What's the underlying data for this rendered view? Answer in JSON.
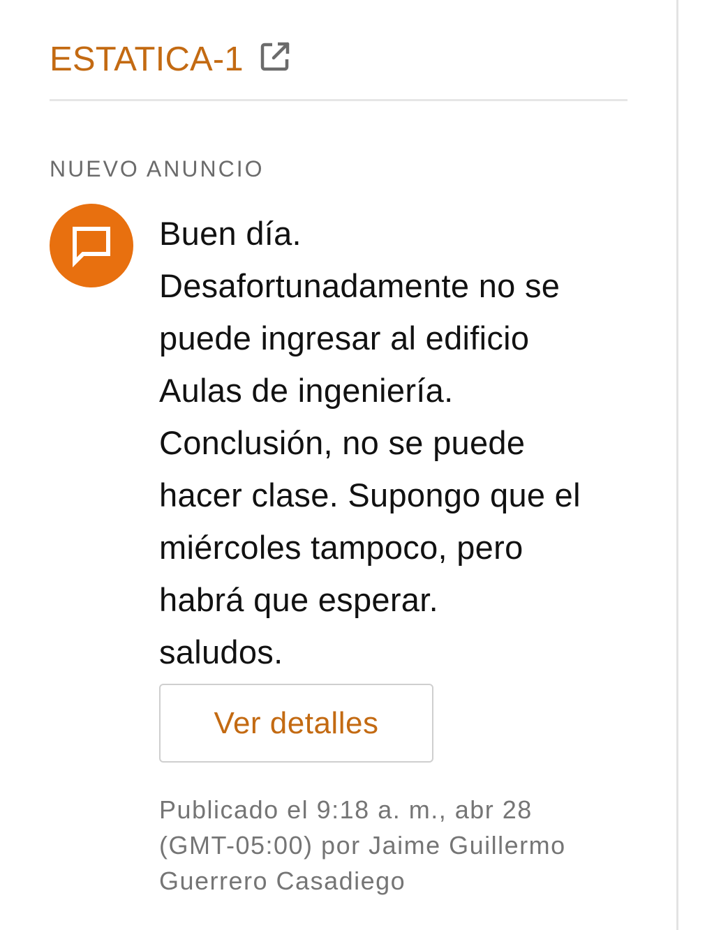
{
  "course": {
    "title": "ESTATICA-1",
    "link_icon": "external-link-icon"
  },
  "section": {
    "label": "NUEVO ANUNCIO"
  },
  "announcement": {
    "icon": "message-bubble-icon",
    "accent_color": "#e8700f",
    "body_lines": [
      "Buen día.",
      "Desafortunadamente no se",
      "puede ingresar al edificio",
      "Aulas de ingeniería.",
      "Conclusión, no se puede",
      "hacer clase. Supongo que el",
      "miércoles tampoco, pero",
      "habrá que esperar.",
      "saludos."
    ],
    "details_button": "Ver detalles",
    "meta_lines": [
      "Publicado el 9:18 a. m., abr 28",
      "(GMT-05:00) por Jaime Guillermo",
      "Guerrero Casadiego"
    ]
  },
  "colors": {
    "link": "#c36a12",
    "label": "#6b6b6b",
    "meta": "#757575"
  }
}
